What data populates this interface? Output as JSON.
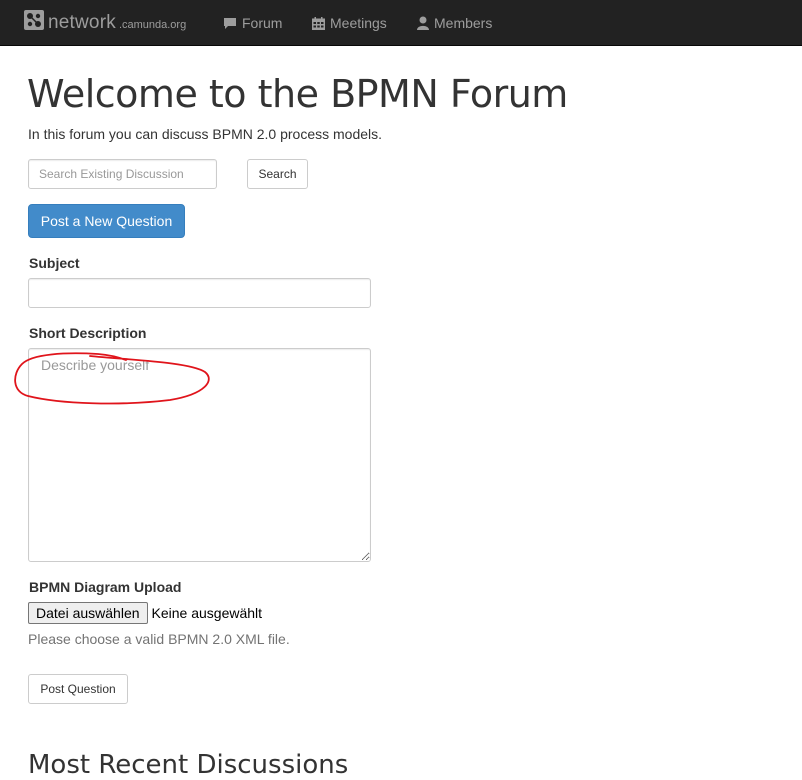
{
  "navbar": {
    "brand": {
      "main": "network",
      "sub": ".camunda.org"
    },
    "links": [
      {
        "label": "Forum",
        "icon": "comment-icon"
      },
      {
        "label": "Meetings",
        "icon": "calendar-icon"
      },
      {
        "label": "Members",
        "icon": "user-icon"
      }
    ]
  },
  "page": {
    "title": "Welcome to the BPMN Forum",
    "intro": "In this forum you can discuss BPMN 2.0 process models."
  },
  "search": {
    "placeholder": "Search Existing Discussion",
    "button_label": "Search"
  },
  "form": {
    "post_new_label": "Post a New Question",
    "subject_label": "Subject",
    "subject_value": "",
    "description_label": "Short Description",
    "description_placeholder": "Describe yourself",
    "upload_label": "BPMN Diagram Upload",
    "file_button_label": "Datei auswählen",
    "file_status": "Keine ausgewählt",
    "upload_help": "Please choose a valid BPMN 2.0 XML file.",
    "submit_label": "Post Question"
  },
  "recent": {
    "heading": "Most Recent Discussions"
  },
  "colors": {
    "navbar_bg": "#222222",
    "navbar_text": "#9d9d9d",
    "primary": "#428bca",
    "annotation": "#e0141b"
  }
}
